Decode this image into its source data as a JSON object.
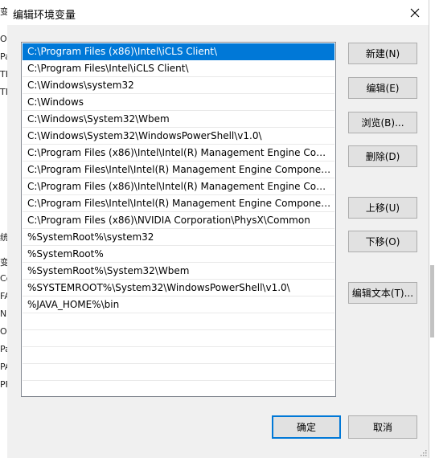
{
  "dialog": {
    "title": "编辑环境变量",
    "close_label": "×"
  },
  "path_list": [
    "C:\\Program Files (x86)\\Intel\\iCLS Client\\",
    "C:\\Program Files\\Intel\\iCLS Client\\",
    "C:\\Windows\\system32",
    "C:\\Windows",
    "C:\\Windows\\System32\\Wbem",
    "C:\\Windows\\System32\\WindowsPowerShell\\v1.0\\",
    "C:\\Program Files (x86)\\Intel\\Intel(R) Management Engine Comp...",
    "C:\\Program Files\\Intel\\Intel(R) Management Engine Component...",
    "C:\\Program Files (x86)\\Intel\\Intel(R) Management Engine Comp...",
    "C:\\Program Files\\Intel\\Intel(R) Management Engine Component...",
    "C:\\Program Files (x86)\\NVIDIA Corporation\\PhysX\\Common",
    "%SystemRoot%\\system32",
    "%SystemRoot%",
    "%SystemRoot%\\System32\\Wbem",
    "%SYSTEMROOT%\\System32\\WindowsPowerShell\\v1.0\\",
    "%JAVA_HOME%\\bin"
  ],
  "selected_index": 0,
  "buttons": {
    "new": "新建(N)",
    "edit": "编辑(E)",
    "browse": "浏览(B)...",
    "delete": "删除(D)",
    "move_up": "上移(U)",
    "move_down": "下移(O)",
    "edit_text": "编辑文本(T)...",
    "ok": "确定",
    "cancel": "取消"
  },
  "background_fragments": [
    "变",
    "O",
    "Pa",
    "TE",
    "TN",
    "统",
    "变",
    "Cd",
    "FA",
    "NI",
    "O",
    "Pa",
    "PA",
    "PF"
  ],
  "colors": {
    "selection": "#0078d7",
    "dialog_bg": "#f0f0f0",
    "button_bg": "#e1e1e1",
    "button_border": "#adadad"
  }
}
